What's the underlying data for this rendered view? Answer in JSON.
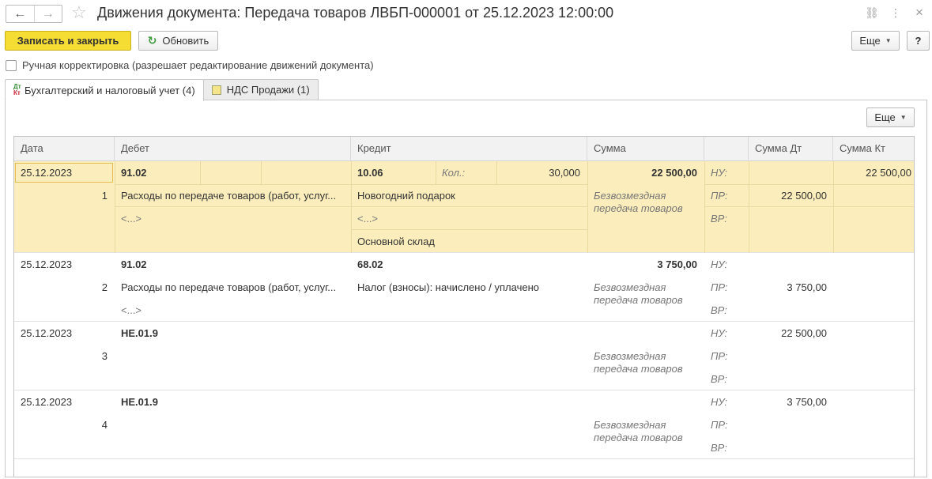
{
  "window": {
    "title": "Движения документа: Передача товаров ЛВБП-000001 от 25.12.2023 12:00:00",
    "back_icon": "←",
    "forward_icon": "→",
    "star_icon": "☆",
    "link_icon": "⛓",
    "menu_icon": "⋮",
    "close_icon": "×"
  },
  "toolbar": {
    "save_close_label": "Записать и закрыть",
    "refresh_icon": "↻",
    "refresh_label": "Обновить",
    "more_label": "Еще",
    "help_label": "?"
  },
  "manual_edit": {
    "label": "Ручная корректировка (разрешает редактирование движений документа)",
    "checked": false
  },
  "tabs": [
    {
      "label": "Бухгалтерский и налоговый учет (4)",
      "icon": "dt-kt-icon",
      "active": true
    },
    {
      "label": "НДС Продажи (1)",
      "icon": "register-icon",
      "active": false
    }
  ],
  "panel": {
    "more_label": "Еще"
  },
  "table": {
    "headers": {
      "date": "Дата",
      "debit": "Дебет",
      "credit": "Кредит",
      "sum": "Сумма",
      "blank": "",
      "sum_dt": "Сумма Дт",
      "sum_kt": "Сумма Кт"
    },
    "rows": [
      {
        "date": "25.12.2023",
        "num": "1",
        "debit_account": "91.02",
        "debit_sub1": "Расходы по передаче товаров (работ, услуг...",
        "debit_sub2": "<...>",
        "credit_account": "10.06",
        "qty_label": "Кол.:",
        "qty": "30,000",
        "credit_sub1": "Новогодний подарок",
        "credit_sub2": "<...>",
        "credit_sub3": "Основной склад",
        "sum": "22 500,00",
        "content": "Безвозмездная передача товаров",
        "nu": "НУ:",
        "pr": "ПР:",
        "vr": "ВР:",
        "nu_dt": "",
        "nu_kt": "22 500,00",
        "pr_dt": "22 500,00"
      },
      {
        "date": "25.12.2023",
        "num": "2",
        "debit_account": "91.02",
        "debit_sub1": "Расходы по передаче товаров (работ, услуг...",
        "debit_sub2": "<...>",
        "credit_account": "68.02",
        "credit_sub1": "Налог (взносы): начислено / уплачено",
        "sum": "3 750,00",
        "content": "Безвозмездная передача товаров",
        "nu": "НУ:",
        "pr": "ПР:",
        "vr": "ВР:",
        "pr_dt": "3 750,00"
      },
      {
        "date": "25.12.2023",
        "num": "3",
        "debit_account": "НЕ.01.9",
        "content": "Безвозмездная передача товаров",
        "nu": "НУ:",
        "pr": "ПР:",
        "vr": "ВР:",
        "nu_dt": "22 500,00"
      },
      {
        "date": "25.12.2023",
        "num": "4",
        "debit_account": "НЕ.01.9",
        "content": "Безвозмездная передача товаров",
        "nu": "НУ:",
        "pr": "ПР:",
        "vr": "ВР:",
        "nu_dt": "3 750,00"
      }
    ]
  }
}
